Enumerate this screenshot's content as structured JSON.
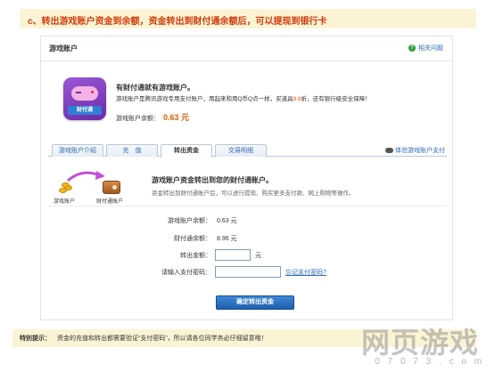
{
  "banner": {
    "text": "c、转出游戏账户资金到余额，资金转出到财付通余额后，可以提现到银行卡"
  },
  "card": {
    "title": "游戏账户",
    "help_icon": "help-icon",
    "help_link": "相关问题"
  },
  "intro": {
    "logo_icon": "gamepad-icon",
    "logo_text": "财付通",
    "title": "有财付通就有游戏账户。",
    "desc_before": "游戏账户是腾讯游戏专用支付账户，用起来和用Q币Q点一样，买道具",
    "desc_highlight": "8.8",
    "desc_after": "折，还有银行级安全保障！",
    "balance_label": "游戏账户余额：",
    "balance_value": "0.63 元"
  },
  "tabs": [
    {
      "label": "游戏账户介绍"
    },
    {
      "label": "充　值"
    },
    {
      "label": "转出资金"
    },
    {
      "label": "交易明细"
    }
  ],
  "experience_link": "体验游戏账户支付",
  "flow": {
    "from_label": "游戏账户",
    "to_label": "财付通账户"
  },
  "transfer": {
    "title": "游戏账户资金转出到您的财付通账户。",
    "desc": "资金转出到财付通账户后，可以进行提现、购买更多支付款、网上购物等操作。"
  },
  "form": {
    "game_balance_label": "游戏账户余额：",
    "game_balance_value": "0.63 元",
    "tenpay_balance_label": "财付通余额：",
    "tenpay_balance_value": "8.96 元",
    "amount_label": "转出金额：",
    "amount_value": "",
    "amount_unit": "元",
    "password_label": "请输入支付密码：",
    "password_value": "",
    "forgot_link": "忘记支付密码?",
    "submit_label": "确定转出资金"
  },
  "tip": {
    "label": "特别提示：",
    "text": "资金的充值和转出都需要验证“支付密码”，所以请各位同学务必仔细留意哦！"
  },
  "watermark": {
    "main": "网页游戏",
    "sub": "0 7 0 7 3 . c o m"
  }
}
